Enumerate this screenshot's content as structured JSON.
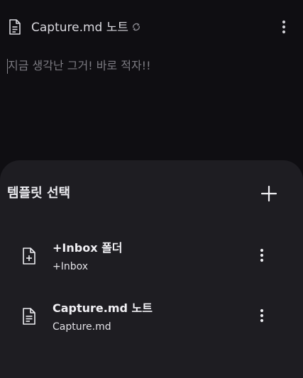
{
  "header": {
    "title": "Capture.md 노트",
    "icons": {
      "document": "file-lines-icon",
      "sync": "sync-icon",
      "menu": "more-vertical-icon"
    }
  },
  "editor": {
    "placeholder": "지금 생각난 그거! 바로 적자!!"
  },
  "sheet": {
    "title": "템플릿 선택",
    "add_icon": "plus-icon",
    "items": [
      {
        "name": "+Inbox 폴더",
        "subtitle": "+Inbox",
        "icon": "file-plus-icon"
      },
      {
        "name": "Capture.md 노트",
        "subtitle": "Capture.md",
        "icon": "file-lines-icon"
      }
    ]
  },
  "colors": {
    "background": "#0f0e12",
    "sheet": "#1e1d22",
    "text": "#ececf0",
    "muted": "#7c7b82"
  }
}
